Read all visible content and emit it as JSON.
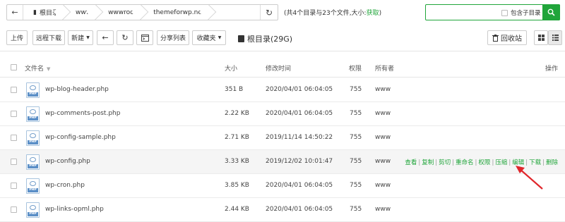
{
  "pathbar": {
    "crumbs": [
      "根目录",
      "www",
      "wwwroot",
      "themeforwp.net"
    ]
  },
  "summary": {
    "text": "(共4个目录与23个文件,大小:",
    "link": "获取",
    "close": ")"
  },
  "search": {
    "include_sub": "包含子目录"
  },
  "toolbar": {
    "upload": "上传",
    "remote_download": "远程下载",
    "new": "新建",
    "share_list": "分享列表",
    "favorites": "收藏夹",
    "disk": "根目录(29G)",
    "recycle": "回收站"
  },
  "table": {
    "headers": {
      "name": "文件名",
      "size": "大小",
      "mtime": "修改时间",
      "perm": "权限",
      "owner": "所有者",
      "ops": "操作"
    },
    "rows": [
      {
        "name": "wp-blog-header.php",
        "size": "351 B",
        "mtime": "2020/04/01 06:04:05",
        "perm": "755",
        "owner": "www"
      },
      {
        "name": "wp-comments-post.php",
        "size": "2.22 KB",
        "mtime": "2020/04/01 06:04:05",
        "perm": "755",
        "owner": "www"
      },
      {
        "name": "wp-config-sample.php",
        "size": "2.71 KB",
        "mtime": "2019/11/14 14:50:22",
        "perm": "755",
        "owner": "www"
      },
      {
        "name": "wp-config.php",
        "size": "3.33 KB",
        "mtime": "2019/12/02 10:01:47",
        "perm": "755",
        "owner": "www"
      },
      {
        "name": "wp-cron.php",
        "size": "3.85 KB",
        "mtime": "2020/04/01 06:04:05",
        "perm": "755",
        "owner": "www"
      },
      {
        "name": "wp-links-opml.php",
        "size": "2.44 KB",
        "mtime": "2020/04/01 06:04:05",
        "perm": "755",
        "owner": "www"
      }
    ],
    "ops": [
      "查看",
      "复制",
      "剪切",
      "重命名",
      "权限",
      "压缩",
      "编辑",
      "下载",
      "删除"
    ],
    "file_badge": "PHP"
  },
  "colors": {
    "accent": "#20a53a",
    "arrow": "#e0262b",
    "file_icon": "#5b8fc7"
  }
}
